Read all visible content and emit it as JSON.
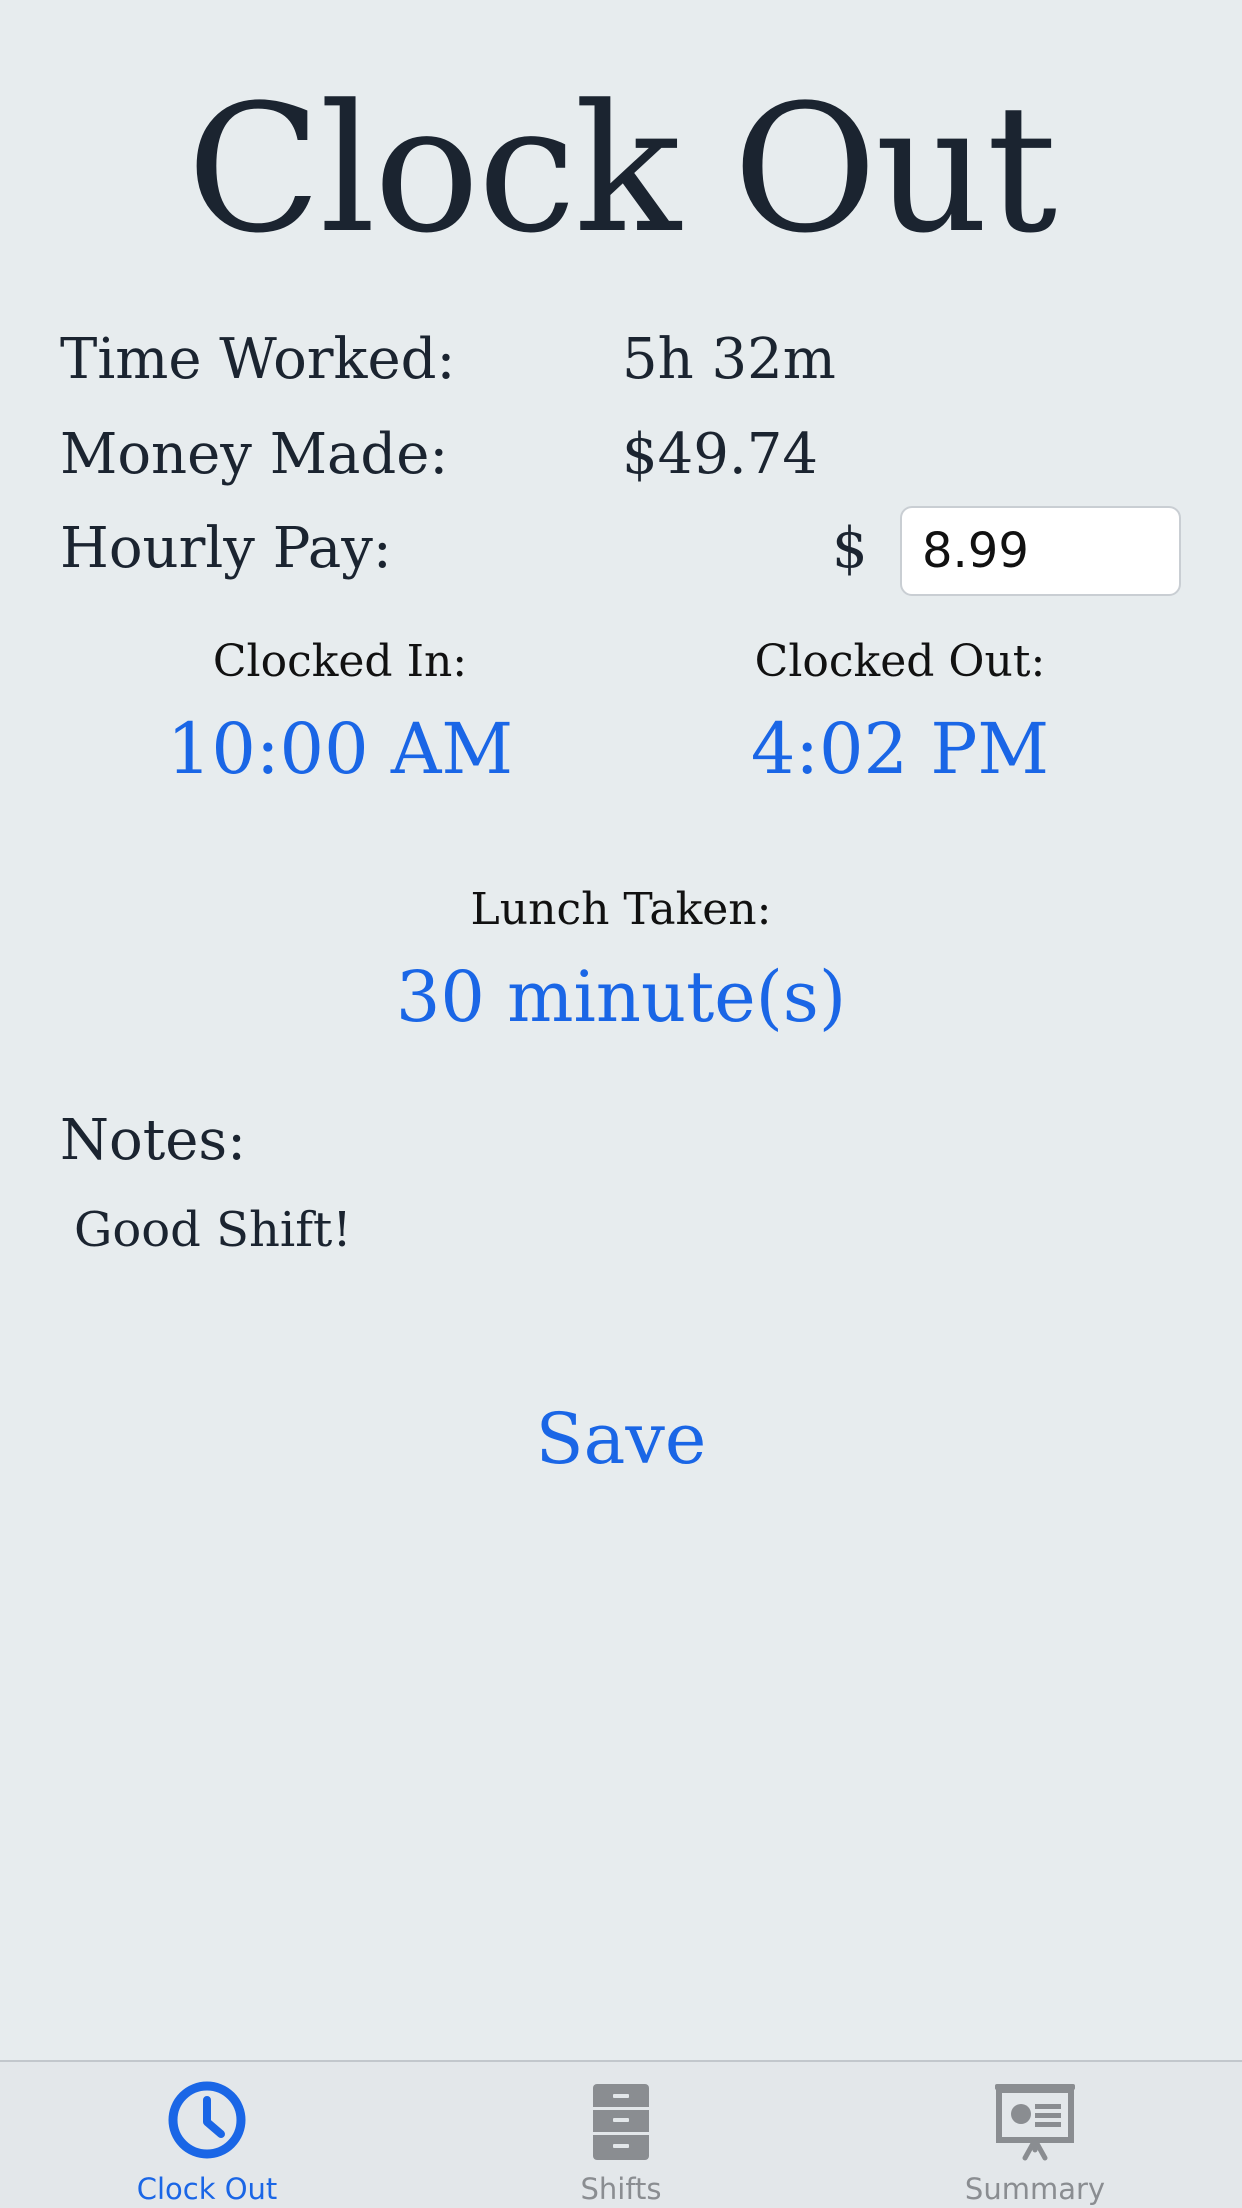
{
  "title": "Clock Out",
  "stats": {
    "time_worked_label": "Time Worked:",
    "time_worked_value": "5h 32m",
    "money_made_label": "Money Made:",
    "money_made_value": "$49.74",
    "hourly_pay_label": "Hourly Pay:",
    "currency_symbol": "$",
    "hourly_pay_value": "8.99"
  },
  "times": {
    "clocked_in_label": "Clocked In:",
    "clocked_in_value": "10:00 AM",
    "clocked_out_label": "Clocked Out:",
    "clocked_out_value": "4:02 PM"
  },
  "lunch": {
    "label": "Lunch Taken:",
    "value": "30 minute(s)"
  },
  "notes": {
    "label": "Notes:",
    "text": "Good Shift!"
  },
  "save_label": "Save",
  "tabbar": {
    "tabs": [
      {
        "label": "Clock Out",
        "icon": "clock-icon",
        "active": true
      },
      {
        "label": "Shifts",
        "icon": "cabinet-icon",
        "active": false
      },
      {
        "label": "Summary",
        "icon": "presentation-icon",
        "active": false
      }
    ]
  },
  "colors": {
    "accent": "#1a66e6",
    "background": "#e7ecee",
    "text": "#1b2430",
    "inactive_tab": "#8a8d91"
  }
}
